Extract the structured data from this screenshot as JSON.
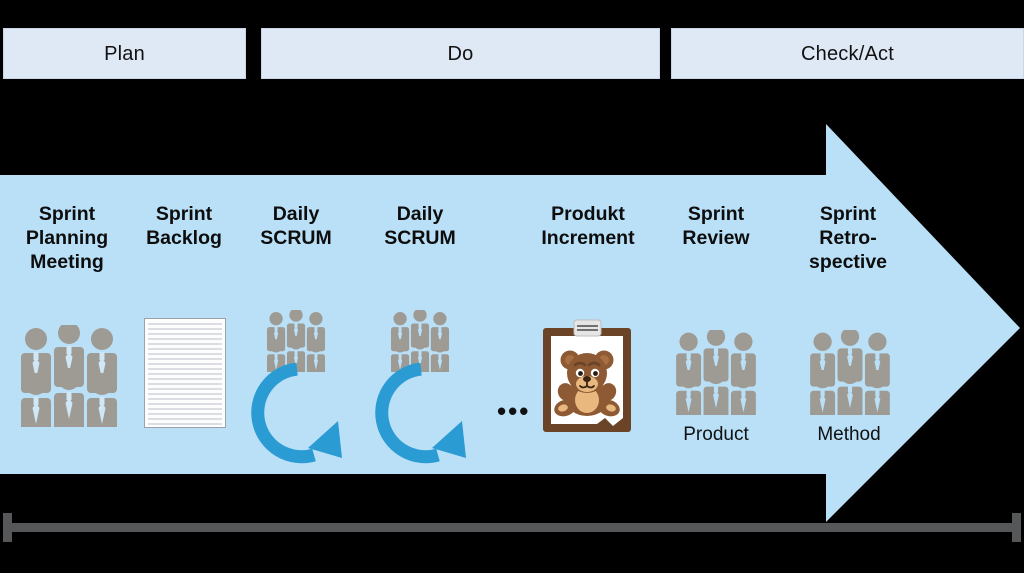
{
  "colors": {
    "background": "#000000",
    "arrow_fill": "#b9e0f7",
    "header_box_fill": "#dfe8f5",
    "header_box_border": "#c9d6e8",
    "people_gray": "#9e9a94",
    "cycle_blue": "#2b9bd4",
    "timeline_gray": "#555759",
    "text_dark": "#0d0d0d",
    "clipboard_brown": "#6b4327",
    "bear_brown": "#8d5a33",
    "bear_light": "#e8b87e"
  },
  "header": {
    "boxes": [
      {
        "label": "Plan"
      },
      {
        "label": "Do"
      },
      {
        "label": "Check/Act"
      }
    ]
  },
  "process": {
    "shape": "right-arrow",
    "steps": [
      {
        "title": "Sprint\nPlanning\nMeeting",
        "icon": "people-group-icon",
        "sublabel": ""
      },
      {
        "title": "Sprint\nBacklog",
        "icon": "lined-document-icon",
        "sublabel": ""
      },
      {
        "title": "Daily\nSCRUM",
        "icon": "people-group-icon+cycle-arrow-icon",
        "sublabel": ""
      },
      {
        "title": "Daily\nSCRUM",
        "icon": "people-group-icon+cycle-arrow-icon",
        "sublabel": ""
      },
      {
        "title": "Produkt\nIncrement",
        "icon": "clipboard-teddy-bear-icon",
        "sublabel": ""
      },
      {
        "title": "Sprint\nReview",
        "icon": "people-group-icon",
        "sublabel": "Product"
      },
      {
        "title": "Sprint\nRetro-\nspective",
        "icon": "people-group-icon",
        "sublabel": "Method"
      }
    ],
    "ellipsis": "•••"
  },
  "timeline": {
    "style": "double-ended-bar",
    "label": ""
  }
}
